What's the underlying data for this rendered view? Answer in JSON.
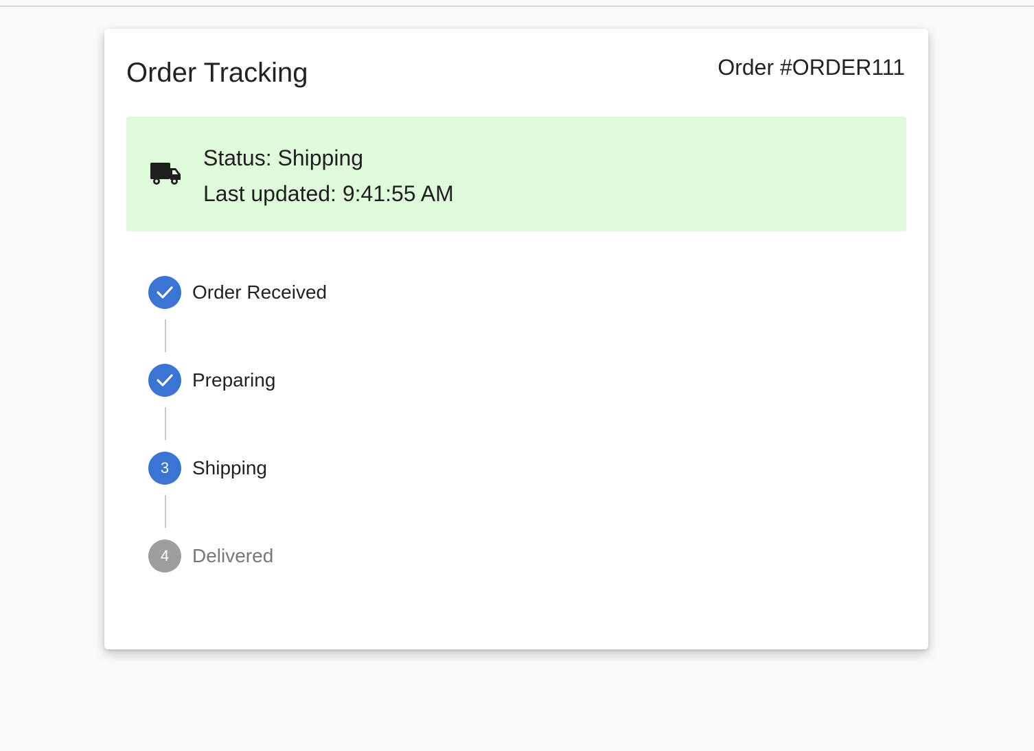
{
  "header": {
    "title": "Order Tracking",
    "order_label": "Order #ORDER111"
  },
  "status": {
    "icon": "truck-icon",
    "status_line": "Status: Shipping",
    "updated_line": "Last updated: 9:41:55 AM",
    "background_color": "#dffbdc"
  },
  "steps": [
    {
      "label": "Order Received",
      "state": "completed",
      "marker": "check-icon"
    },
    {
      "label": "Preparing",
      "state": "completed",
      "marker": "check-icon"
    },
    {
      "label": "Shipping",
      "state": "active",
      "marker": "3"
    },
    {
      "label": "Delivered",
      "state": "pending",
      "marker": "4"
    }
  ],
  "colors": {
    "accent": "#3b74d3",
    "pending": "#9e9e9e"
  }
}
